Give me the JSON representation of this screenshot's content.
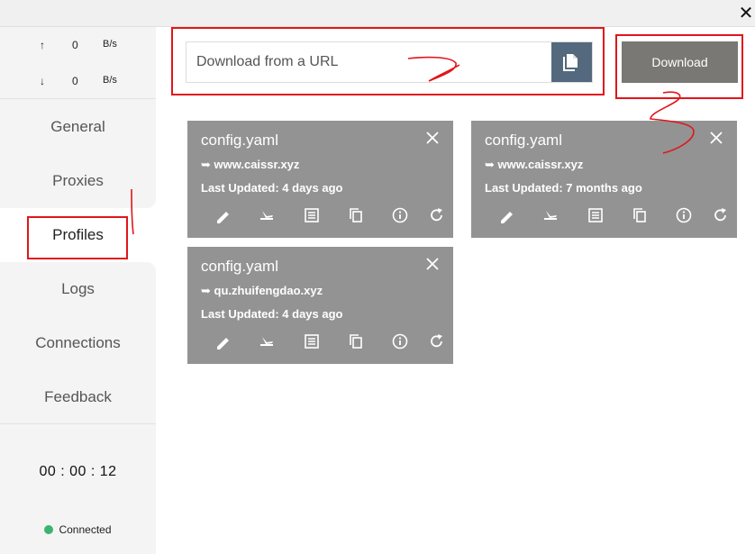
{
  "window": {
    "close_glyph": "✕"
  },
  "speed": {
    "upload": {
      "arrow": "↑",
      "value": "0",
      "unit": "B/s"
    },
    "download": {
      "arrow": "↓",
      "value": "0",
      "unit": "B/s"
    }
  },
  "nav": {
    "items": [
      {
        "label": "General"
      },
      {
        "label": "Proxies"
      },
      {
        "label": "Profiles"
      },
      {
        "label": "Logs"
      },
      {
        "label": "Connections"
      },
      {
        "label": "Feedback"
      }
    ],
    "active": "Profiles"
  },
  "timer": "00 : 00 : 12",
  "status": {
    "label": "Connected",
    "color": "#3cb371"
  },
  "download_bar": {
    "placeholder": "Download from a URL",
    "button_label": "Download"
  },
  "profiles": [
    {
      "name": "config.yaml",
      "url": "➥ www.caissr.xyz",
      "updated": "Last Updated: 4 days ago"
    },
    {
      "name": "config.yaml",
      "url": "➥ www.caissr.xyz",
      "updated": "Last Updated: 7 months ago"
    },
    {
      "name": "config.yaml",
      "url": "➥ qu.zhuifengdao.xyz",
      "updated": "Last Updated: 4 days ago"
    }
  ],
  "colors": {
    "card": "#939393",
    "paste_button": "#54697d",
    "download_button": "#7a7874",
    "annotation": "#e0161c"
  }
}
